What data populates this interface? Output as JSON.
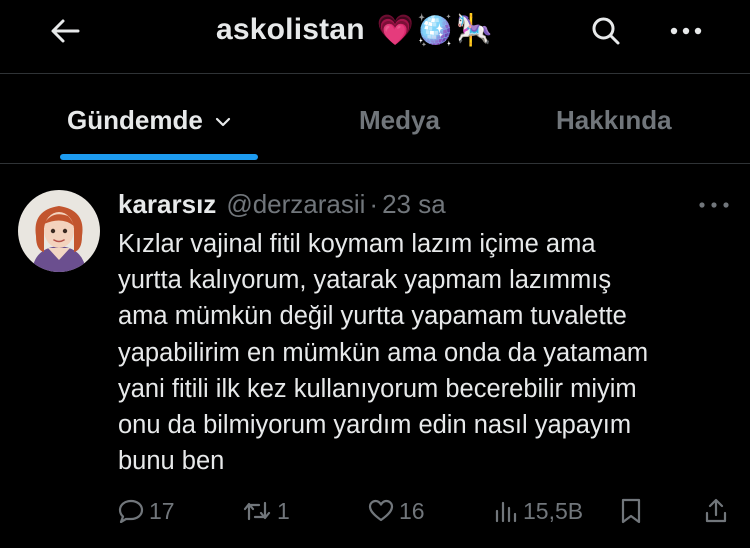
{
  "header": {
    "title": "askolistan",
    "title_emoji": "💗🪩🎠",
    "back_icon": "arrow-left-icon",
    "search_icon": "search-icon",
    "more_icon": "more-horizontal-icon"
  },
  "tabs": [
    {
      "label": "Gündemde",
      "active": true
    },
    {
      "label": "Medya",
      "active": false
    },
    {
      "label": "Hakkında",
      "active": false
    }
  ],
  "tweet": {
    "display_name": "kararsız",
    "handle": "@derzarasii",
    "separator": "·",
    "time": "23 sa",
    "text": "Kızlar vajinal fitil koymam lazım içime ama\nyurtta kalıyorum, yatarak yapmam lazımmış\nama mümkün değil yurtta yapamam tuvalette\nyapabilirim en mümkün ama onda da yatamam\nyani fitili ilk kez kullanıyorum becerebilir miyim\nonu da bilmiyorum yardım edin nasıl yapayım\nbunu ben",
    "actions": {
      "replies": "17",
      "reposts": "1",
      "likes": "16",
      "views": "15,5B"
    }
  },
  "colors": {
    "background": "#000000",
    "text": "#e7e9ea",
    "muted": "#71767b",
    "accent": "#1d9bf0",
    "divider": "#2f3336"
  }
}
